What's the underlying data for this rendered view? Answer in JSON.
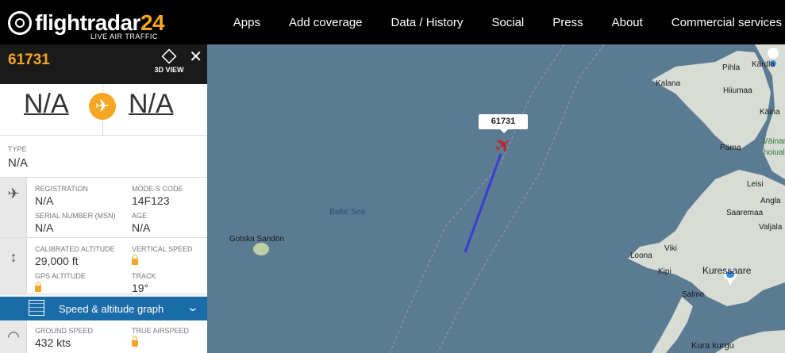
{
  "header": {
    "logo_word": "flightradar",
    "logo_num": "24",
    "logo_tagline": "LIVE AIR TRAFFIC",
    "nav": [
      "Apps",
      "Add coverage",
      "Data / History",
      "Social",
      "Press",
      "About",
      "Commercial services"
    ]
  },
  "panel": {
    "callsign": "61731",
    "view3d_label": "3D VIEW",
    "route": {
      "from": "N/A",
      "to": "N/A"
    },
    "type": {
      "label": "TYPE",
      "value": "N/A"
    },
    "aircraft": {
      "registration_label": "REGISTRATION",
      "registration": "N/A",
      "modes_label": "MODE-S CODE",
      "modes": "14F123",
      "msn_label": "SERIAL NUMBER (MSN)",
      "msn": "N/A",
      "age_label": "AGE",
      "age": "N/A"
    },
    "altitude": {
      "cal_alt_label": "CALIBRATED ALTITUDE",
      "cal_alt": "29,000 ft",
      "vs_label": "VERTICAL SPEED",
      "gps_alt_label": "GPS ALTITUDE",
      "track_label": "TRACK",
      "track": "19°"
    },
    "graph_label": "Speed & altitude graph",
    "speed": {
      "gs_label": "GROUND SPEED",
      "gs": "432 kts",
      "tas_label": "TRUE AIRSPEED"
    }
  },
  "map": {
    "flight_label": "61731",
    "places": [
      "Baltic Sea",
      "Gotska Sandön",
      "Kalana",
      "Pihla",
      "Kärdla",
      "Hiiumaa",
      "Käina",
      "Pärna",
      "Väinameri",
      "hoiuala",
      "Leisi",
      "Angla",
      "Saaremaa",
      "Valjala",
      "Viki",
      "Loona",
      "Kipi",
      "Kuressaare",
      "Salme",
      "Kura kurgu"
    ]
  },
  "colors": {
    "accent": "#f5a623",
    "track": "#3b3bd6",
    "aircraft": "#c0262d",
    "land": "#d7dcd4",
    "sea": "#5b7b93"
  }
}
